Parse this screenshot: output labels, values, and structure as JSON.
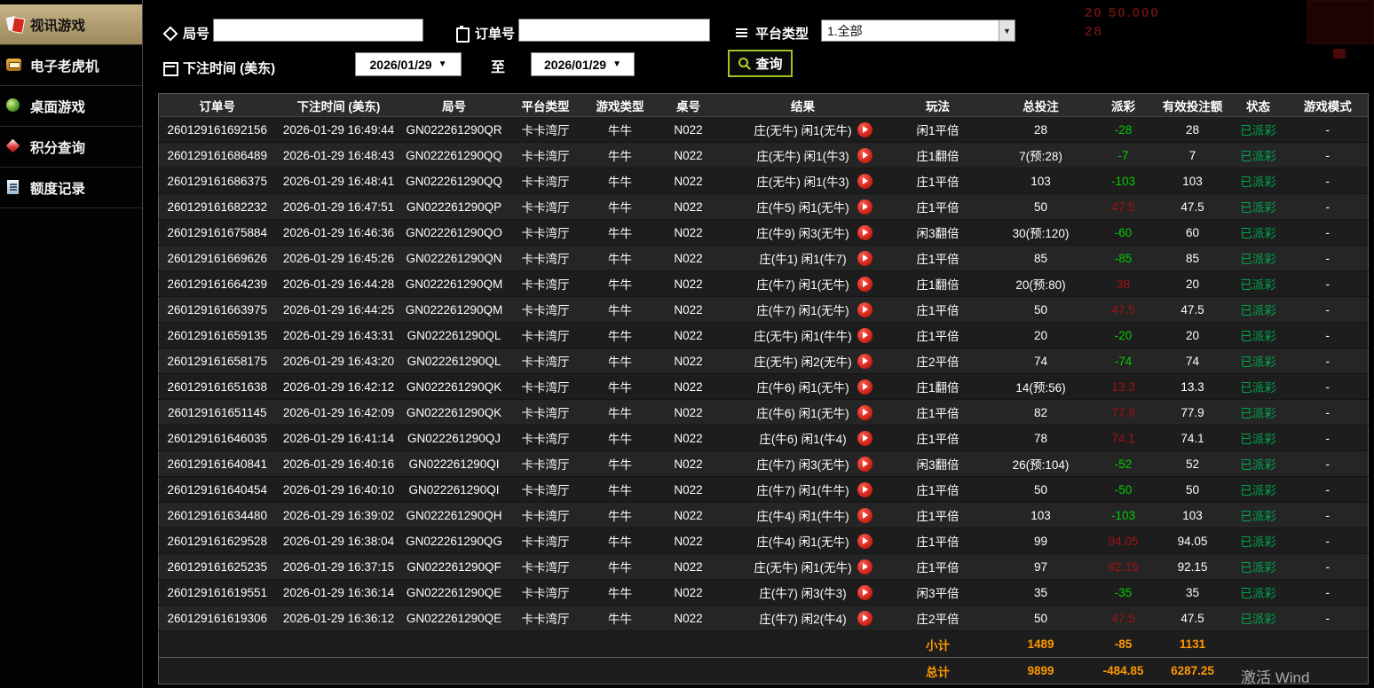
{
  "sidebar": {
    "items": [
      {
        "label": "视讯游戏",
        "icon": "cards-icon",
        "active": true
      },
      {
        "label": "电子老虎机",
        "icon": "slot-icon",
        "active": false
      },
      {
        "label": "桌面游戏",
        "icon": "table-game-icon",
        "active": false
      },
      {
        "label": "积分查询",
        "icon": "gem-icon",
        "active": false
      },
      {
        "label": "额度记录",
        "icon": "document-icon",
        "active": false
      }
    ]
  },
  "filters": {
    "round_label": "局号",
    "round_value": "",
    "order_label": "订单号",
    "order_value": "",
    "platform_label": "平台类型",
    "platform_value": "1.全部",
    "time_label": "下注时间 (美东)",
    "date_from": "2026/01/29",
    "to_label": "至",
    "date_to": "2026/01/29",
    "search_label": "查询"
  },
  "table": {
    "headers": [
      "订单号",
      "下注时间 (美东)",
      "局号",
      "平台类型",
      "游戏类型",
      "桌号",
      "结果",
      "玩法",
      "总投注",
      "派彩",
      "有效投注额",
      "状态",
      "游戏模式"
    ],
    "rows": [
      {
        "order": "260129161692156",
        "time": "2026-01-29 16:49:44",
        "round": "GN022261290QR",
        "platform": "卡卡湾厅",
        "game": "牛牛",
        "table_no": "N022",
        "result": "庄(无牛) 闲1(无牛)",
        "play_method": "闲1平倍",
        "total_bet": "28",
        "payout": "-28",
        "payout_color": "green",
        "valid_bet": "28",
        "status": "已派彩",
        "mode": "-"
      },
      {
        "order": "260129161686489",
        "time": "2026-01-29 16:48:43",
        "round": "GN022261290QQ",
        "platform": "卡卡湾厅",
        "game": "牛牛",
        "table_no": "N022",
        "result": "庄(无牛) 闲1(牛3)",
        "play_method": "庄1翻倍",
        "total_bet": "7(预:28)",
        "payout": "-7",
        "payout_color": "green",
        "valid_bet": "7",
        "status": "已派彩",
        "mode": "-"
      },
      {
        "order": "260129161686375",
        "time": "2026-01-29 16:48:41",
        "round": "GN022261290QQ",
        "platform": "卡卡湾厅",
        "game": "牛牛",
        "table_no": "N022",
        "result": "庄(无牛) 闲1(牛3)",
        "play_method": "庄1平倍",
        "total_bet": "103",
        "payout": "-103",
        "payout_color": "green",
        "valid_bet": "103",
        "status": "已派彩",
        "mode": "-"
      },
      {
        "order": "260129161682232",
        "time": "2026-01-29 16:47:51",
        "round": "GN022261290QP",
        "platform": "卡卡湾厅",
        "game": "牛牛",
        "table_no": "N022",
        "result": "庄(牛5) 闲1(无牛)",
        "play_method": "庄1平倍",
        "total_bet": "50",
        "payout": "47.5",
        "payout_color": "red",
        "valid_bet": "47.5",
        "status": "已派彩",
        "mode": "-"
      },
      {
        "order": "260129161675884",
        "time": "2026-01-29 16:46:36",
        "round": "GN022261290QO",
        "platform": "卡卡湾厅",
        "game": "牛牛",
        "table_no": "N022",
        "result": "庄(牛9) 闲3(无牛)",
        "play_method": "闲3翻倍",
        "total_bet": "30(预:120)",
        "payout": "-60",
        "payout_color": "green",
        "valid_bet": "60",
        "status": "已派彩",
        "mode": "-"
      },
      {
        "order": "260129161669626",
        "time": "2026-01-29 16:45:26",
        "round": "GN022261290QN",
        "platform": "卡卡湾厅",
        "game": "牛牛",
        "table_no": "N022",
        "result": "庄(牛1) 闲1(牛7)",
        "play_method": "庄1平倍",
        "total_bet": "85",
        "payout": "-85",
        "payout_color": "green",
        "valid_bet": "85",
        "status": "已派彩",
        "mode": "-"
      },
      {
        "order": "260129161664239",
        "time": "2026-01-29 16:44:28",
        "round": "GN022261290QM",
        "platform": "卡卡湾厅",
        "game": "牛牛",
        "table_no": "N022",
        "result": "庄(牛7) 闲1(无牛)",
        "play_method": "庄1翻倍",
        "total_bet": "20(预:80)",
        "payout": "38",
        "payout_color": "red",
        "valid_bet": "20",
        "status": "已派彩",
        "mode": "-"
      },
      {
        "order": "260129161663975",
        "time": "2026-01-29 16:44:25",
        "round": "GN022261290QM",
        "platform": "卡卡湾厅",
        "game": "牛牛",
        "table_no": "N022",
        "result": "庄(牛7) 闲1(无牛)",
        "play_method": "庄1平倍",
        "total_bet": "50",
        "payout": "47.5",
        "payout_color": "red",
        "valid_bet": "47.5",
        "status": "已派彩",
        "mode": "-"
      },
      {
        "order": "260129161659135",
        "time": "2026-01-29 16:43:31",
        "round": "GN022261290QL",
        "platform": "卡卡湾厅",
        "game": "牛牛",
        "table_no": "N022",
        "result": "庄(无牛) 闲1(牛牛)",
        "play_method": "庄1平倍",
        "total_bet": "20",
        "payout": "-20",
        "payout_color": "green",
        "valid_bet": "20",
        "status": "已派彩",
        "mode": "-"
      },
      {
        "order": "260129161658175",
        "time": "2026-01-29 16:43:20",
        "round": "GN022261290QL",
        "platform": "卡卡湾厅",
        "game": "牛牛",
        "table_no": "N022",
        "result": "庄(无牛) 闲2(无牛)",
        "play_method": "庄2平倍",
        "total_bet": "74",
        "payout": "-74",
        "payout_color": "green",
        "valid_bet": "74",
        "status": "已派彩",
        "mode": "-"
      },
      {
        "order": "260129161651638",
        "time": "2026-01-29 16:42:12",
        "round": "GN022261290QK",
        "platform": "卡卡湾厅",
        "game": "牛牛",
        "table_no": "N022",
        "result": "庄(牛6) 闲1(无牛)",
        "play_method": "庄1翻倍",
        "total_bet": "14(预:56)",
        "payout": "13.3",
        "payout_color": "red",
        "valid_bet": "13.3",
        "status": "已派彩",
        "mode": "-"
      },
      {
        "order": "260129161651145",
        "time": "2026-01-29 16:42:09",
        "round": "GN022261290QK",
        "platform": "卡卡湾厅",
        "game": "牛牛",
        "table_no": "N022",
        "result": "庄(牛6) 闲1(无牛)",
        "play_method": "庄1平倍",
        "total_bet": "82",
        "payout": "77.9",
        "payout_color": "red",
        "valid_bet": "77.9",
        "status": "已派彩",
        "mode": "-"
      },
      {
        "order": "260129161646035",
        "time": "2026-01-29 16:41:14",
        "round": "GN022261290QJ",
        "platform": "卡卡湾厅",
        "game": "牛牛",
        "table_no": "N022",
        "result": "庄(牛6) 闲1(牛4)",
        "play_method": "庄1平倍",
        "total_bet": "78",
        "payout": "74.1",
        "payout_color": "red",
        "valid_bet": "74.1",
        "status": "已派彩",
        "mode": "-"
      },
      {
        "order": "260129161640841",
        "time": "2026-01-29 16:40:16",
        "round": "GN022261290QI",
        "platform": "卡卡湾厅",
        "game": "牛牛",
        "table_no": "N022",
        "result": "庄(牛7) 闲3(无牛)",
        "play_method": "闲3翻倍",
        "total_bet": "26(预:104)",
        "payout": "-52",
        "payout_color": "green",
        "valid_bet": "52",
        "status": "已派彩",
        "mode": "-"
      },
      {
        "order": "260129161640454",
        "time": "2026-01-29 16:40:10",
        "round": "GN022261290QI",
        "platform": "卡卡湾厅",
        "game": "牛牛",
        "table_no": "N022",
        "result": "庄(牛7) 闲1(牛牛)",
        "play_method": "庄1平倍",
        "total_bet": "50",
        "payout": "-50",
        "payout_color": "green",
        "valid_bet": "50",
        "status": "已派彩",
        "mode": "-"
      },
      {
        "order": "260129161634480",
        "time": "2026-01-29 16:39:02",
        "round": "GN022261290QH",
        "platform": "卡卡湾厅",
        "game": "牛牛",
        "table_no": "N022",
        "result": "庄(牛4) 闲1(牛牛)",
        "play_method": "庄1平倍",
        "total_bet": "103",
        "payout": "-103",
        "payout_color": "green",
        "valid_bet": "103",
        "status": "已派彩",
        "mode": "-"
      },
      {
        "order": "260129161629528",
        "time": "2026-01-29 16:38:04",
        "round": "GN022261290QG",
        "platform": "卡卡湾厅",
        "game": "牛牛",
        "table_no": "N022",
        "result": "庄(牛4) 闲1(无牛)",
        "play_method": "庄1平倍",
        "total_bet": "99",
        "payout": "94.05",
        "payout_color": "red",
        "valid_bet": "94.05",
        "status": "已派彩",
        "mode": "-"
      },
      {
        "order": "260129161625235",
        "time": "2026-01-29 16:37:15",
        "round": "GN022261290QF",
        "platform": "卡卡湾厅",
        "game": "牛牛",
        "table_no": "N022",
        "result": "庄(无牛) 闲1(无牛)",
        "play_method": "庄1平倍",
        "total_bet": "97",
        "payout": "92.15",
        "payout_color": "red",
        "valid_bet": "92.15",
        "status": "已派彩",
        "mode": "-"
      },
      {
        "order": "260129161619551",
        "time": "2026-01-29 16:36:14",
        "round": "GN022261290QE",
        "platform": "卡卡湾厅",
        "game": "牛牛",
        "table_no": "N022",
        "result": "庄(牛7) 闲3(牛3)",
        "play_method": "闲3平倍",
        "total_bet": "35",
        "payout": "-35",
        "payout_color": "green",
        "valid_bet": "35",
        "status": "已派彩",
        "mode": "-"
      },
      {
        "order": "260129161619306",
        "time": "2026-01-29 16:36:12",
        "round": "GN022261290QE",
        "platform": "卡卡湾厅",
        "game": "牛牛",
        "table_no": "N022",
        "result": "庄(牛7) 闲2(牛4)",
        "play_method": "庄2平倍",
        "total_bet": "50",
        "payout": "47.5",
        "payout_color": "red",
        "valid_bet": "47.5",
        "status": "已派彩",
        "mode": "-"
      }
    ],
    "subtotal": {
      "label": "小计",
      "total_bet": "1489",
      "payout": "-85",
      "valid_bet": "1131"
    },
    "total": {
      "label": "总计",
      "total_bet": "9899",
      "payout": "-484.85",
      "valid_bet": "6287.25"
    }
  },
  "background": {
    "remnant_line1": "20  50.000",
    "remnant_line2": "28",
    "watermark": "激活 Wind"
  },
  "icons": {
    "round_filter": "tag-icon",
    "order_filter": "clipboard-icon",
    "platform_filter": "list-icon",
    "time_filter": "calendar-icon",
    "search": "magnifier-icon",
    "result": "play-icon",
    "dropdown": "chevron-down-icon"
  },
  "colors": {
    "payout_positive_red": "#a01212",
    "payout_negative_green": "#00cf00",
    "status_paid_green": "#00a651",
    "footer_orange": "#ff9900",
    "active_menu_tan": "#b3a173",
    "search_button_green": "#9fc520"
  }
}
